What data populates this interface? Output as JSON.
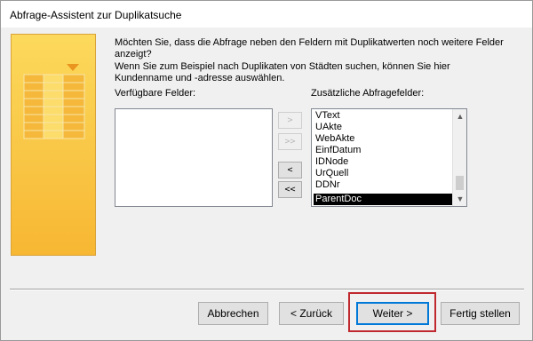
{
  "window": {
    "title": "Abfrage-Assistent zur Duplikatsuche"
  },
  "instructions": {
    "line1": "Möchten Sie, dass die Abfrage neben den Feldern mit Duplikatwerten noch weitere Felder",
    "line2": "anzeigt?",
    "line3": "Wenn Sie zum Beispiel nach Duplikaten von Städten suchen, können Sie hier",
    "line4": "Kundenname und -adresse auswählen."
  },
  "available_fields": {
    "label": "Verfügbare Felder:",
    "items": []
  },
  "additional_fields": {
    "label": "Zusätzliche Abfragefelder:",
    "items": [
      "VText",
      "UAkte",
      "WebAkte",
      "EinfDatum",
      "IDNode",
      "UrQuell",
      "DDNr",
      "ParentDoc"
    ],
    "selected": "ParentDoc"
  },
  "move_buttons": {
    "add_one": ">",
    "add_all": ">>",
    "remove_one": "<",
    "remove_all": "<<"
  },
  "footer_buttons": {
    "cancel": "Abbrechen",
    "back": "< Zurück",
    "next": "Weiter >",
    "finish": "Fertig stellen"
  },
  "colors": {
    "wizard_image": "#f7b733",
    "selection": "#000000",
    "default_button_border": "#0078d7",
    "highlight_frame": "#c0282f"
  }
}
